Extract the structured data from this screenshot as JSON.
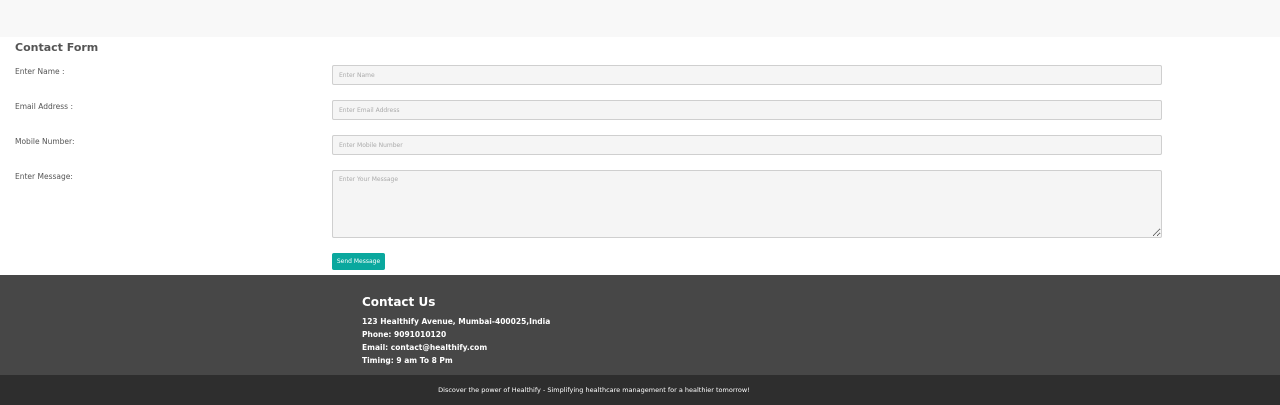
{
  "form": {
    "title": "Contact Form",
    "fields": [
      {
        "label": "Enter Name :",
        "placeholder": "Enter Name",
        "value": ""
      },
      {
        "label": "Email Address :",
        "placeholder": "Enter Email Address",
        "value": ""
      },
      {
        "label": "Mobile Number:",
        "placeholder": "Enter Mobile Number",
        "value": ""
      },
      {
        "label": "Enter Message:",
        "placeholder": "Enter Your Message",
        "value": ""
      }
    ],
    "submit_label": "Send Message",
    "submit_color": "#0aa89e"
  },
  "footer": {
    "heading": "Contact Us",
    "address": "123 Healthify Avenue, Mumbai-400025,India",
    "phone": "Phone: 9091010120",
    "email": "Email: contact@healthify.com",
    "timing": "Timing: 9 am To 8 Pm",
    "tagline": "Discover the power of Healthify - Simplifying healthcare management for a healthier tomorrow!"
  },
  "colors": {
    "footer_main_bg": "#474747",
    "footer_bottom_bg": "#2e2e2e",
    "page_band_bg": "#f8f8f8"
  }
}
